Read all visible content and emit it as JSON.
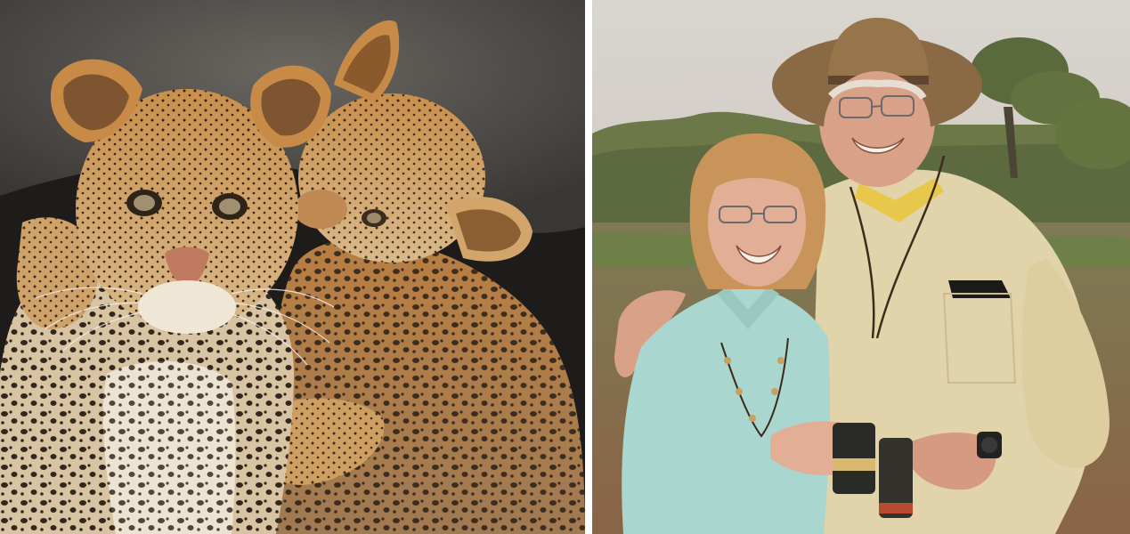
{
  "images": [
    {
      "subject": "leopard-cubs-photo",
      "colors": {
        "rock": "#4a4845",
        "shadow": "#1c1a18",
        "fur": "#c89a5a",
        "fur_light": "#e6cfa8",
        "spot": "#2a2018"
      }
    },
    {
      "subject": "couple-on-safari-photo",
      "colors": {
        "sky": "#d7d4cf",
        "bush": "#6d7a4a",
        "ground": "#8d6a4a",
        "grass": "#6f8a4a",
        "shirt_woman": "#a9d6cf",
        "shirt_man": "#e3d6ad",
        "hat": "#8a6a44"
      }
    }
  ]
}
